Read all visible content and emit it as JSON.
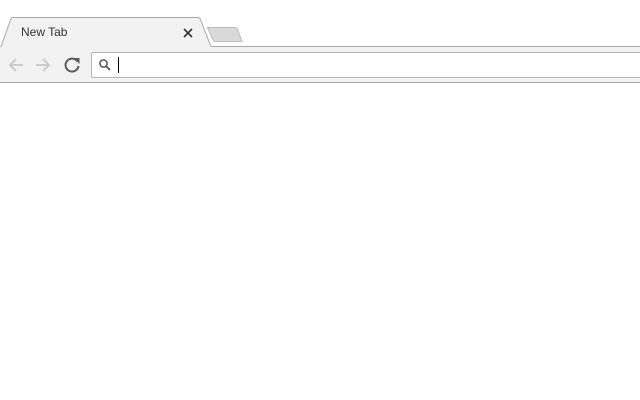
{
  "tabs": [
    {
      "title": "New Tab",
      "active": true
    }
  ],
  "toolbar": {
    "back_enabled": false,
    "forward_enabled": false,
    "omnibox": {
      "value": "",
      "placeholder": ""
    }
  },
  "icons": {
    "back": "arrow-left-icon",
    "forward": "arrow-right-icon",
    "reload": "reload-icon",
    "search": "search-icon",
    "close": "close-icon",
    "new_tab": "new-tab-icon"
  },
  "colors": {
    "tab_active_bg": "#f2f2f2",
    "tab_border": "#a9a9a9",
    "toolbar_bg": "#f2f2f2",
    "disabled_icon": "#c8c8c8",
    "active_icon": "#5a5a5a",
    "new_tab_fill": "#d9d9d9",
    "new_tab_stroke": "#bdbdbd"
  }
}
